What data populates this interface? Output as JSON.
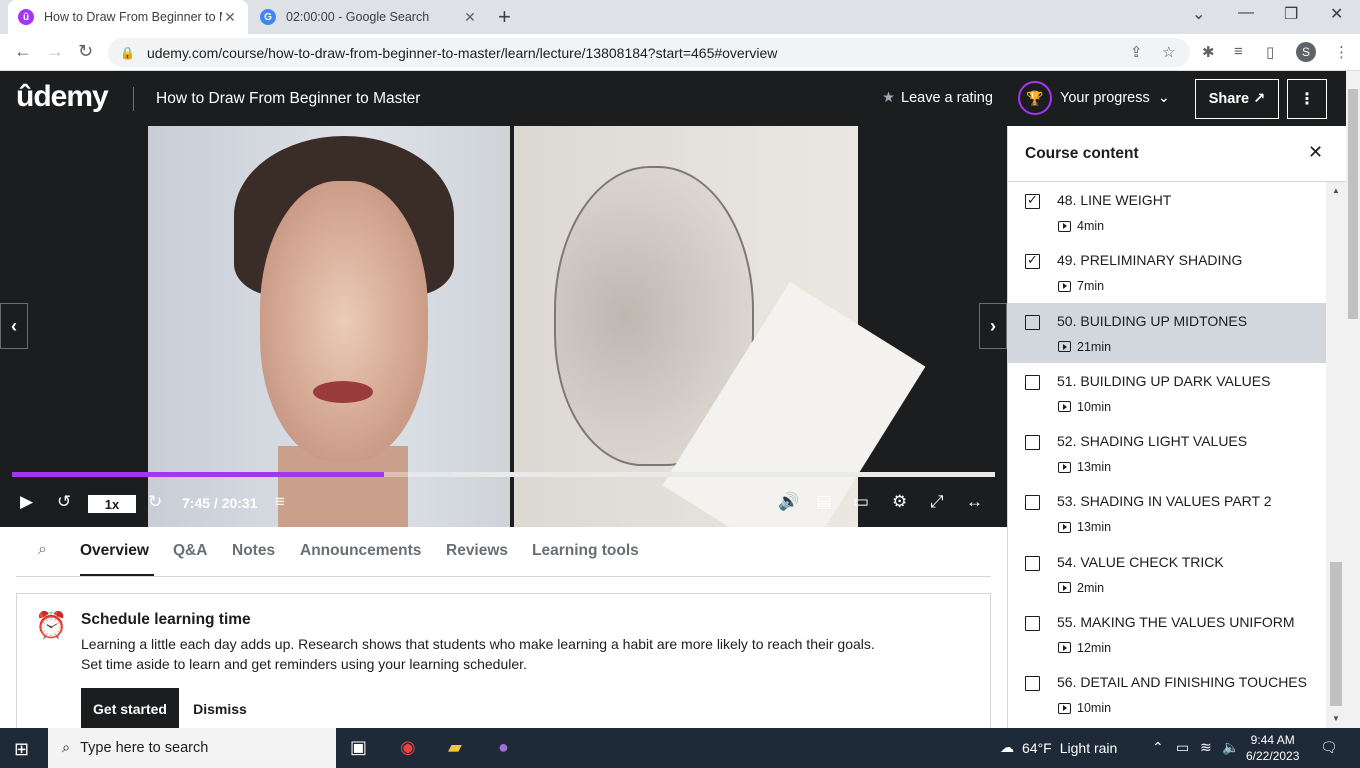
{
  "browser": {
    "tabs": [
      {
        "title": "How to Draw From Beginner to M",
        "active": true
      },
      {
        "title": "02:00:00 - Google Search",
        "active": false
      }
    ],
    "url": "udemy.com/course/how-to-draw-from-beginner-to-master/learn/lecture/13808184?start=465#overview",
    "profile_initial": "S"
  },
  "header": {
    "logo": "ûdemy",
    "course_title": "How to Draw From Beginner to Master",
    "rating_label": "Leave a rating",
    "progress_label": "Your progress",
    "share_label": "Share ↗"
  },
  "player": {
    "speed": "1x",
    "timecode": "7:45 / 20:31",
    "progress_fraction": 0.378,
    "buffered_fraction": 0.449
  },
  "subtabs": [
    "Overview",
    "Q&A",
    "Notes",
    "Announcements",
    "Reviews",
    "Learning tools"
  ],
  "schedule": {
    "title": "Schedule learning time",
    "line1": "Learning a little each day adds up. Research shows that students who make learning a habit are more likely to reach their goals.",
    "line2": "Set time aside to learn and get reminders using your learning scheduler.",
    "start_label": "Get started",
    "dismiss_label": "Dismiss"
  },
  "sidebar": {
    "title": "Course content",
    "lectures": [
      {
        "title": "48. LINE WEIGHT",
        "duration": "4min",
        "done": true,
        "current": false
      },
      {
        "title": "49. PRELIMINARY SHADING",
        "duration": "7min",
        "done": true,
        "current": false
      },
      {
        "title": "50. BUILDING UP MIDTONES",
        "duration": "21min",
        "done": false,
        "current": true
      },
      {
        "title": "51. BUILDING UP DARK VALUES",
        "duration": "10min",
        "done": false,
        "current": false
      },
      {
        "title": "52. SHADING LIGHT VALUES",
        "duration": "13min",
        "done": false,
        "current": false
      },
      {
        "title": "53. SHADING IN VALUES PART 2",
        "duration": "13min",
        "done": false,
        "current": false
      },
      {
        "title": "54. VALUE CHECK TRICK",
        "duration": "2min",
        "done": false,
        "current": false
      },
      {
        "title": "55. MAKING THE VALUES UNIFORM",
        "duration": "12min",
        "done": false,
        "current": false
      },
      {
        "title": "56. DETAIL AND FINISHING TOUCHES",
        "duration": "10min",
        "done": false,
        "current": false
      }
    ]
  },
  "taskbar": {
    "search_placeholder": "Type here to search",
    "weather_temp": "64°F",
    "weather_desc": "Light rain",
    "time": "9:44 AM",
    "date": "6/22/2023"
  },
  "colors": {
    "accent": "#a435f0",
    "dark": "#1c1d1f",
    "current_row": "#d1d7dc"
  }
}
